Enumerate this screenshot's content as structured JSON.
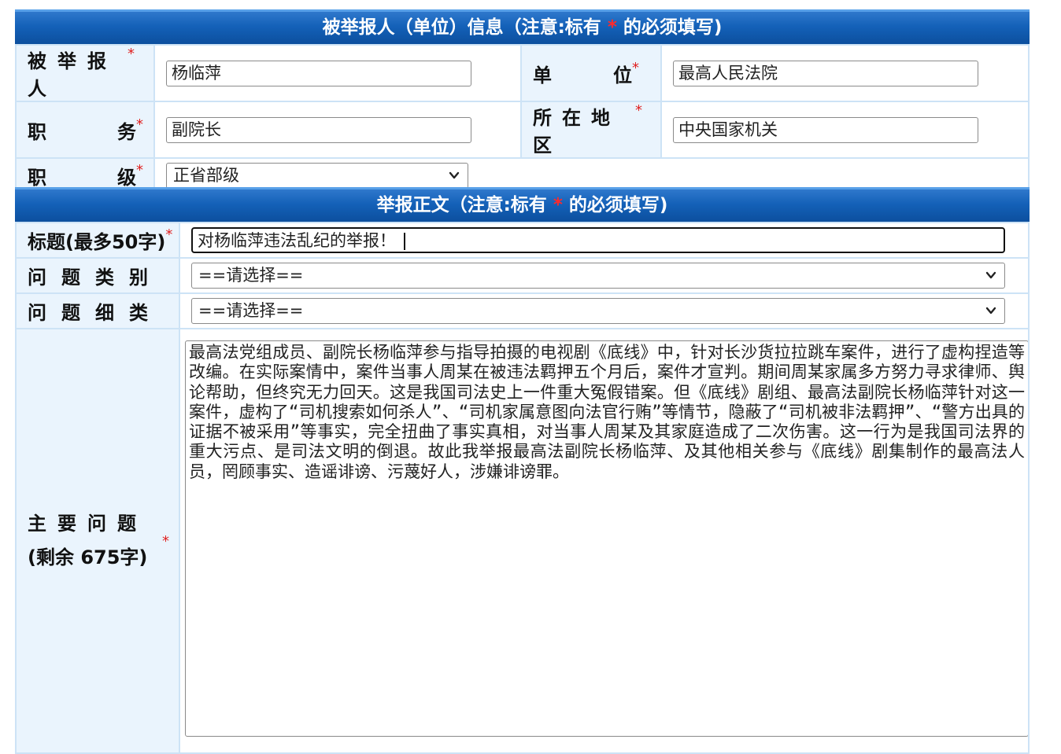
{
  "section1": {
    "banner_main": "被举报人（单位）信息（注意:标有",
    "banner_star": "*",
    "banner_tail": "的必须填写)",
    "rows": {
      "person_label": "被举报人",
      "person_value": "杨临萍",
      "unit_label": "单位",
      "unit_value": "最高人民法院",
      "duty_label": "职务",
      "duty_value": "副院长",
      "location_label": "所在地区",
      "location_value": "中央国家机关",
      "rank_label": "职级",
      "rank_value": "正省部级"
    },
    "star": "*"
  },
  "section2": {
    "banner_main": "举报正文（注意:标有",
    "banner_star": "*",
    "banner_tail": "的必须填写)",
    "title_label": "标题(最多50字)",
    "title_value": "对杨临萍违法乱纪的举报！",
    "category_label": "问题类别",
    "category_value": "==请选择==",
    "subcategory_label": "问题细类",
    "subcategory_value": "==请选择==",
    "main_label": "主要问题",
    "remaining_label": "(剩余 675字)",
    "main_text": "最高法党组成员、副院长杨临萍参与指导拍摄的电视剧《底线》中，针对长沙货拉拉跳车案件，进行了虚构捏造等改编。在实际案情中，案件当事人周某在被违法羁押五个月后，案件才宣判。期间周某家属多方努力寻求律师、舆论帮助，但终究无力回天。这是我国司法史上一件重大冤假错案。但《底线》剧组、最高法副院长杨临萍针对这一案件，虚构了“司机搜索如何杀人”、“司机家属意图向法官行贿”等情节，隐蔽了“司机被非法羁押”、“警方出具的证据不被采用”等事实，完全扭曲了事实真相，对当事人周某及其家庭造成了二次伤害。这一行为是我国司法界的重大污点、是司法文明的倒退。故此我举报最高法副院长杨临萍、及其他相关参与《底线》剧集制作的最高法人员，罔顾事实、造谣诽谤、污蔑好人，涉嫌诽谤罪。",
    "star": "*"
  },
  "icons": {
    "dropdown": "chevron-down-icon"
  }
}
